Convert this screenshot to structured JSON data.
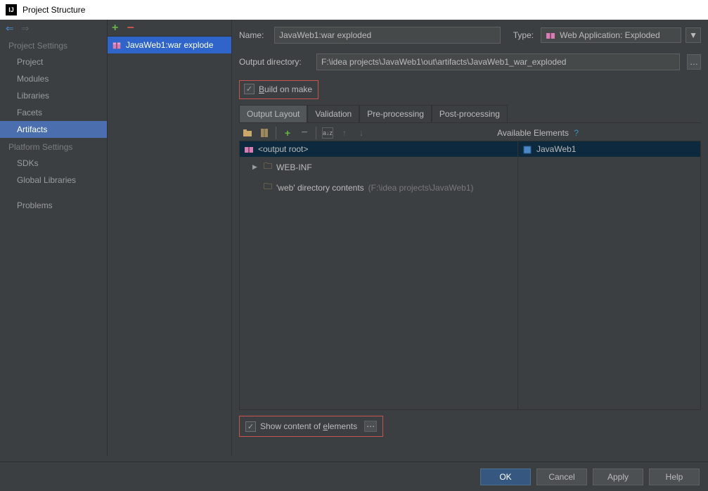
{
  "window": {
    "title": "Project Structure"
  },
  "sidebar": {
    "sectionA": "Project Settings",
    "items": [
      "Project",
      "Modules",
      "Libraries",
      "Facets",
      "Artifacts"
    ],
    "sectionB": "Platform Settings",
    "itemsB": [
      "SDKs",
      "Global Libraries"
    ],
    "problems": "Problems"
  },
  "middle": {
    "artifact_name": "JavaWeb1:war explode"
  },
  "form": {
    "name_label": "Name:",
    "name_value": "JavaWeb1:war exploded",
    "type_label": "Type:",
    "type_value": "Web Application: Exploded",
    "outdir_label": "Output directory:",
    "outdir_value": "F:\\idea projects\\JavaWeb1\\out\\artifacts\\JavaWeb1_war_exploded",
    "build_on_make": "Build on make"
  },
  "tabs": [
    "Output Layout",
    "Validation",
    "Pre-processing",
    "Post-processing"
  ],
  "layout": {
    "available_label": "Available Elements",
    "output_root": "<output root>",
    "webinf": "WEB-INF",
    "web_dir": "'web' directory contents",
    "web_dir_path": "(F:\\idea projects\\JavaWeb1)",
    "avail_item": "JavaWeb1"
  },
  "show_content": "Show content of elements",
  "buttons": {
    "ok": "OK",
    "cancel": "Cancel",
    "apply": "Apply",
    "help": "Help"
  }
}
